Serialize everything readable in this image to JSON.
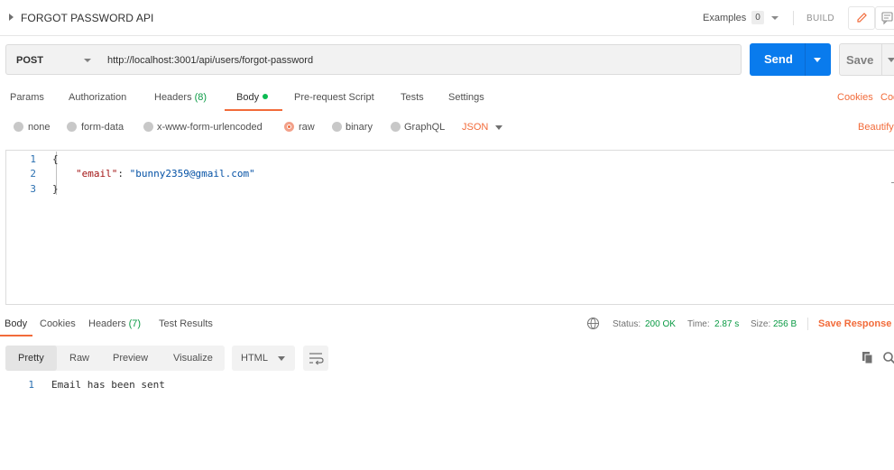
{
  "header": {
    "request_name": "FORGOT PASSWORD API",
    "examples_label": "Examples",
    "examples_count": "0",
    "build_label": "BUILD"
  },
  "request": {
    "method": "POST",
    "url": "http://localhost:3001/api/users/forgot-password",
    "send_label": "Send",
    "save_label": "Save"
  },
  "request_tabs": {
    "params": "Params",
    "authorization": "Authorization",
    "headers": "Headers",
    "headers_count": "(8)",
    "body": "Body",
    "pre_request": "Pre-request Script",
    "tests": "Tests",
    "settings": "Settings",
    "cookies": "Cookies",
    "code": "Code"
  },
  "body_types": {
    "none": "none",
    "form_data": "form-data",
    "urlencoded": "x-www-form-urlencoded",
    "raw": "raw",
    "binary": "binary",
    "graphql": "GraphQL",
    "format": "JSON",
    "beautify": "Beautify",
    "selected": "raw"
  },
  "editor": {
    "lines": [
      {
        "num": "1",
        "text": "{"
      },
      {
        "num": "2",
        "key": "\"email\"",
        "colon": ": ",
        "value": "\"bunny2359@gmail.com\""
      },
      {
        "num": "3",
        "text": "}"
      }
    ]
  },
  "response_tabs": {
    "body": "Body",
    "cookies": "Cookies",
    "headers": "Headers",
    "headers_count": "(7)",
    "test_results": "Test Results"
  },
  "response_status": {
    "status_label": "Status:",
    "status_value": "200 OK",
    "time_label": "Time:",
    "time_value": "2.87 s",
    "size_label": "Size:",
    "size_value": "256 B",
    "save_response": "Save Response"
  },
  "response_view": {
    "pretty": "Pretty",
    "raw": "Raw",
    "preview": "Preview",
    "visualize": "Visualize",
    "format": "HTML",
    "selected": "Pretty"
  },
  "response_body": {
    "line_num": "1",
    "text": "Email has been sent"
  },
  "colors": {
    "accent": "#f26b3a",
    "send_blue": "#097bed",
    "success_green": "#0a9a44",
    "dot_green": "#0cbb52"
  }
}
